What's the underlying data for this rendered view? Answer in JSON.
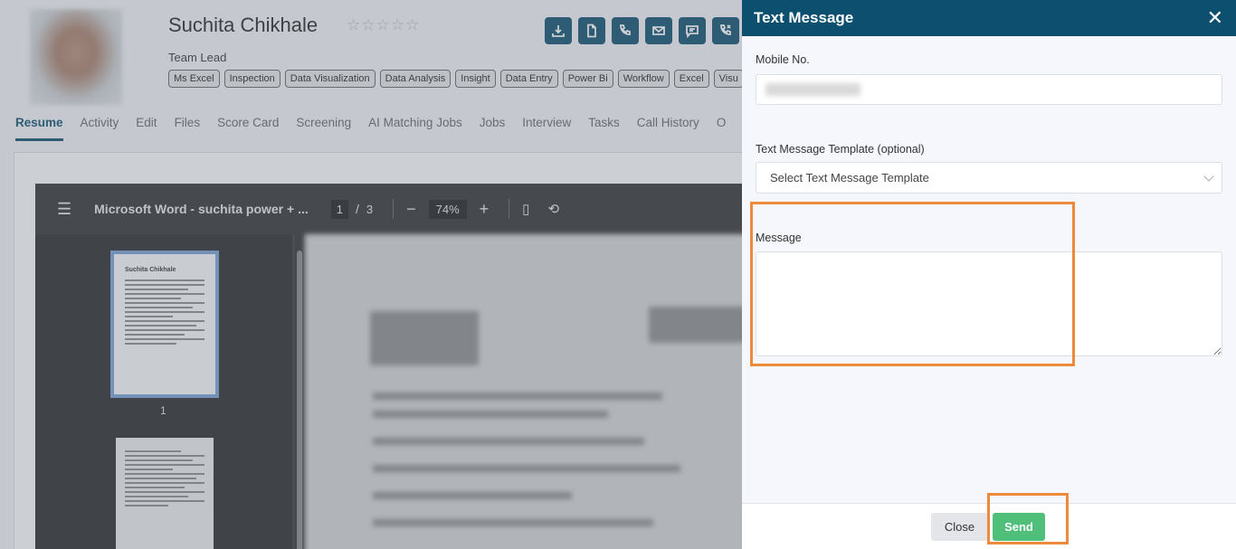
{
  "candidate": {
    "name": "Suchita Chikhale",
    "rating": "☆☆☆☆☆",
    "title": "Team Lead",
    "skills": [
      "Ms Excel",
      "Inspection",
      "Data Visualization",
      "Data Analysis",
      "Insight",
      "Data Entry",
      "Power Bi",
      "Workflow",
      "Excel",
      "Visu"
    ]
  },
  "action_icons": [
    "download-icon",
    "document-icon",
    "phone-icon",
    "email-icon",
    "message-icon",
    "call-log-icon"
  ],
  "tabs": [
    "Resume",
    "Activity",
    "Edit",
    "Files",
    "Score Card",
    "Screening",
    "AI Matching Jobs",
    "Jobs",
    "Interview",
    "Tasks",
    "Call History",
    "O"
  ],
  "viewer": {
    "title": "Microsoft Word - suchita power + ...",
    "current_page": "1",
    "page_sep": "/",
    "total_pages": "3",
    "zoom": "74%",
    "thumb_page_label": "1",
    "thumb_name": "Suchita Chikhale"
  },
  "panel": {
    "title": "Text Message",
    "close_symbol": "✕",
    "mobile_label": "Mobile No.",
    "template_label": "Text Message Template (optional)",
    "template_value": "Select Text Message Template",
    "message_label": "Message",
    "close_button": "Close",
    "send_button": "Send"
  },
  "colors": {
    "brand": "#0d4f6e",
    "send": "#4fbf7a",
    "highlight": "#ee8a3c"
  }
}
